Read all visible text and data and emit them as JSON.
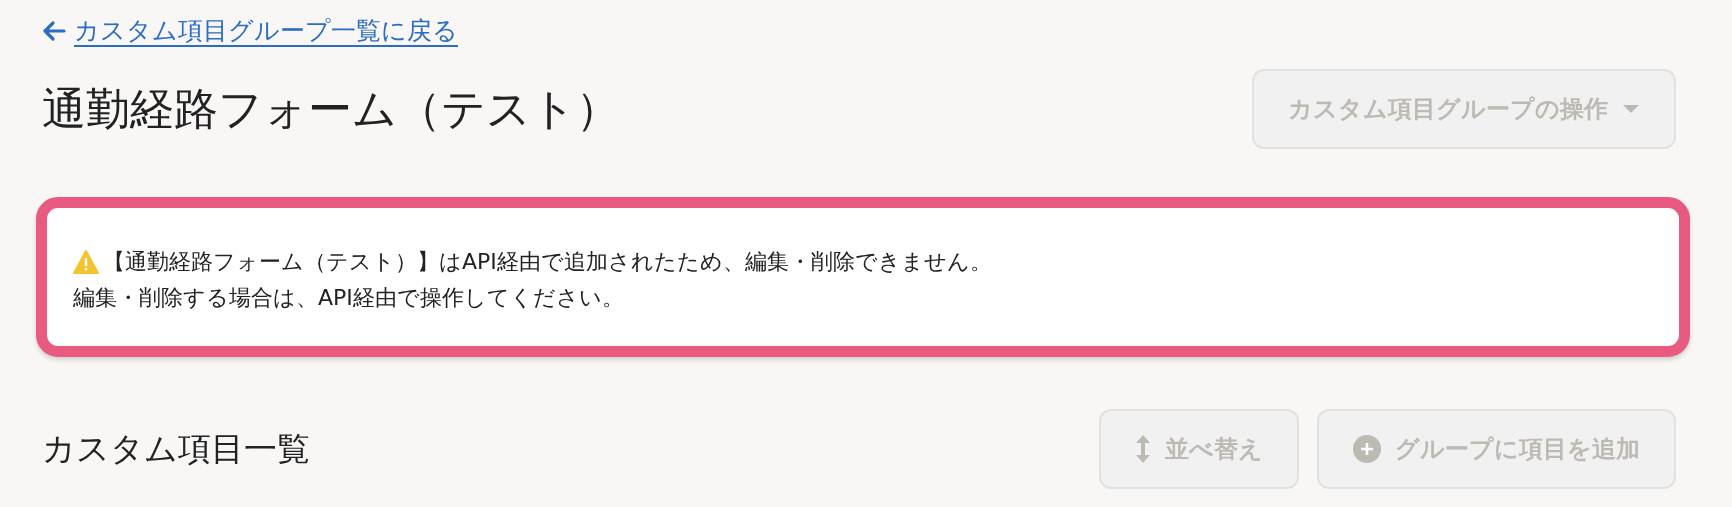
{
  "back_link": {
    "label": "カスタム項目グループ一覧に戻る"
  },
  "page_title": "通勤経路フォーム（テスト）",
  "group_actions_button": {
    "label": "カスタム項目グループの操作",
    "disabled": true
  },
  "alert": {
    "kind": "warning",
    "lines": [
      "【通勤経路フォーム（テスト）】はAPI経由で追加されたため、編集・削除できません。",
      "編集・削除する場合は、API経由で操作してください。"
    ]
  },
  "section": {
    "title": "カスタム項目一覧",
    "buttons": [
      {
        "kind": "sort",
        "label": "並べ替え",
        "disabled": true
      },
      {
        "kind": "add",
        "label": "グループに項目を追加",
        "disabled": true
      }
    ]
  }
}
